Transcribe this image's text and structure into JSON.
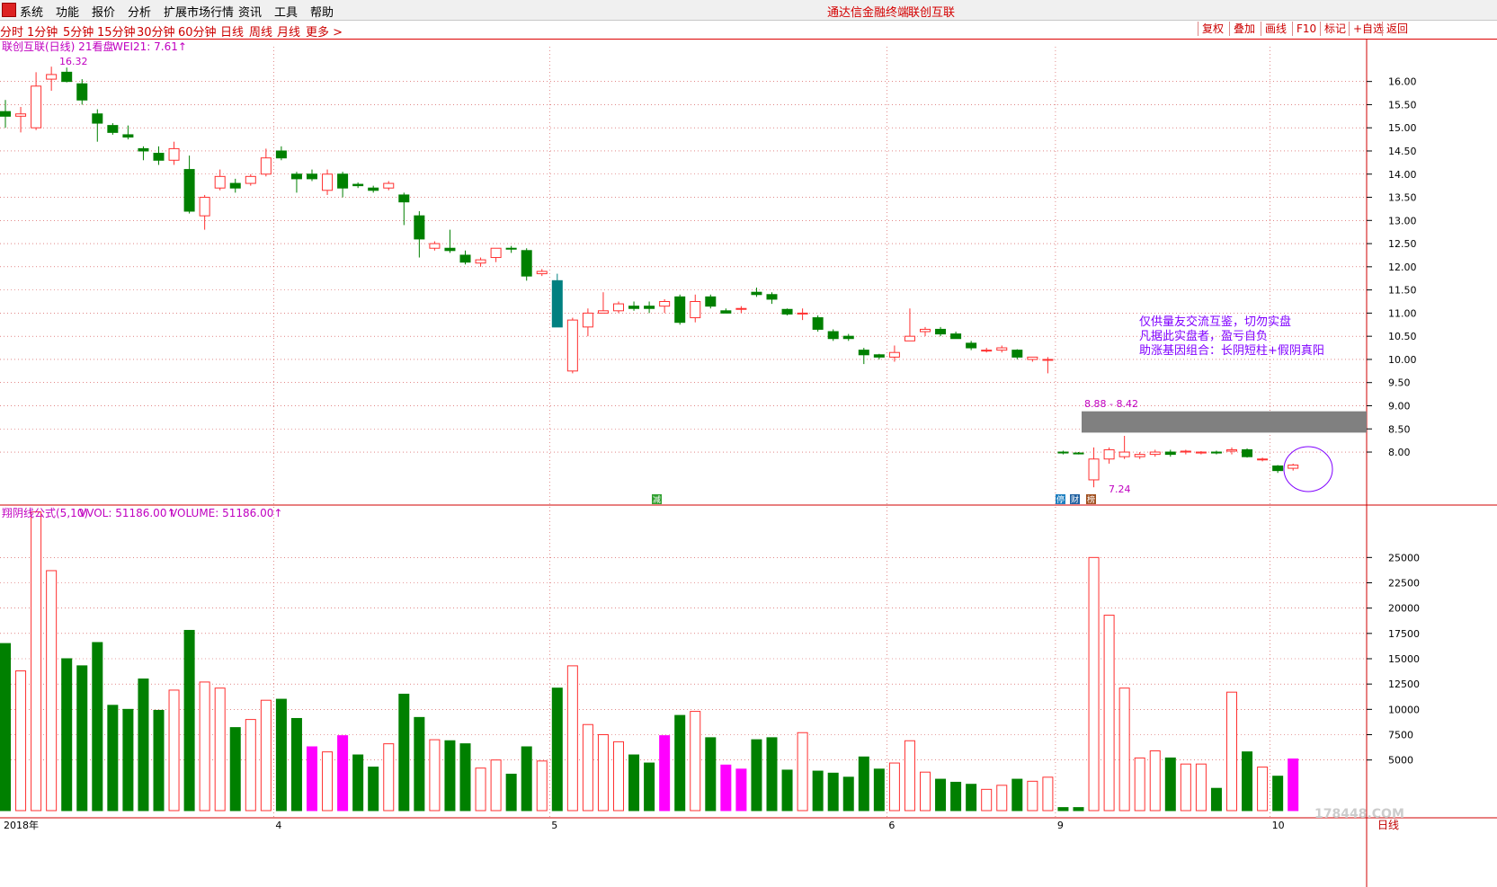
{
  "menu": [
    "系统",
    "功能",
    "报价",
    "分析",
    "扩展市场行情",
    "资讯",
    "工具",
    "帮助"
  ],
  "window_title": "通达信金融终端",
  "stock_name": "联创互联",
  "periods": [
    "分时",
    "1分钟",
    "5分钟",
    "15分钟",
    "30分钟",
    "60分钟",
    "日线",
    "周线",
    "月线",
    "更多 >"
  ],
  "active_period": "日线",
  "right_buttons": [
    "复权",
    "叠加",
    "画线",
    "F10",
    "标记",
    "+自选",
    "返回"
  ],
  "main_header": {
    "name": "联创互联(日线) 21看盘",
    "indicator": "WEI21: 7.61↑"
  },
  "vol_header": {
    "name": "翔阴线公式(5,10)",
    "vvol": "VVOL: 51186.00↑",
    "volume": "VOLUME: 51186.00↑"
  },
  "annotation": [
    "仅供量友交流互鉴，切勿实盘",
    "凡据此实盘者，盈亏自负",
    "助涨基因组合：长阴短柱+假阴真阳"
  ],
  "gap_label": "8.88 - 8.42",
  "max_label": "16.32",
  "min_label": "7.24",
  "icons": [
    "jian-icon",
    "ting-icon",
    "cai-icon",
    "bang-icon"
  ],
  "icon_labels": {
    "jian": "减",
    "ting": "停",
    "cai": "财",
    "bang": "榜"
  },
  "bottom_labels": {
    "year": "2018年",
    "period": "日线",
    "watermark": "178448.COM"
  },
  "colors": {
    "up": "#ff3030",
    "down": "#008000",
    "highlight": "#ff00ff",
    "teal": "#008080",
    "grid": "#d04040",
    "axis": "#000000"
  },
  "chart_data": {
    "type": "candlestick",
    "price_axis": {
      "ticks": [
        16.0,
        15.5,
        15.0,
        14.5,
        14.0,
        13.5,
        13.0,
        12.5,
        12.0,
        11.5,
        11.0,
        10.5,
        10.0,
        9.5,
        9.0,
        8.5,
        8.0
      ],
      "range": [
        7.05,
        16.75
      ]
    },
    "volume_axis": {
      "ticks": [
        25000,
        22500,
        20000,
        17500,
        15000,
        12500,
        10000,
        7500,
        5000
      ],
      "range": [
        0,
        30000
      ]
    },
    "month_labels": [
      {
        "label": "2018年",
        "index": 0
      },
      {
        "label": "4",
        "index": 18
      },
      {
        "label": "5",
        "index": 36
      },
      {
        "label": "6",
        "index": 58
      },
      {
        "label": "9",
        "index": 69
      },
      {
        "label": "10",
        "index": 83
      }
    ],
    "gap_zone": {
      "low": 8.42,
      "high": 8.88
    },
    "candles": [
      {
        "o": 15.35,
        "h": 15.6,
        "c": 15.25,
        "l": 15.0,
        "v": 16500
      },
      {
        "o": 15.25,
        "h": 15.45,
        "c": 15.3,
        "l": 14.9,
        "v": 13800
      },
      {
        "o": 15.0,
        "h": 16.2,
        "c": 15.9,
        "l": 14.95,
        "v": 29500
      },
      {
        "o": 16.05,
        "h": 16.32,
        "c": 16.15,
        "l": 15.8,
        "v": 23700
      },
      {
        "o": 16.2,
        "h": 16.3,
        "c": 16.0,
        "l": 15.98,
        "v": 15000
      },
      {
        "o": 15.95,
        "h": 16.05,
        "c": 15.6,
        "l": 15.5,
        "v": 14300
      },
      {
        "o": 15.3,
        "h": 15.4,
        "c": 15.1,
        "l": 14.7,
        "v": 16600
      },
      {
        "o": 15.05,
        "h": 15.1,
        "c": 14.9,
        "l": 14.85,
        "v": 10400
      },
      {
        "o": 14.85,
        "h": 15.05,
        "c": 14.8,
        "l": 14.75,
        "v": 10000
      },
      {
        "o": 14.55,
        "h": 14.6,
        "c": 14.5,
        "l": 14.3,
        "v": 13000
      },
      {
        "o": 14.45,
        "h": 14.6,
        "c": 14.3,
        "l": 14.2,
        "v": 9900
      },
      {
        "o": 14.3,
        "h": 14.7,
        "c": 14.55,
        "l": 14.2,
        "v": 11900
      },
      {
        "o": 14.1,
        "h": 14.4,
        "c": 13.2,
        "l": 13.15,
        "v": 17800
      },
      {
        "o": 13.1,
        "h": 13.55,
        "c": 13.5,
        "l": 12.8,
        "v": 12700
      },
      {
        "o": 13.7,
        "h": 14.1,
        "c": 13.95,
        "l": 13.65,
        "v": 12100
      },
      {
        "o": 13.8,
        "h": 13.9,
        "c": 13.7,
        "l": 13.6,
        "v": 8200
      },
      {
        "o": 13.8,
        "h": 14.0,
        "c": 13.95,
        "l": 13.75,
        "v": 9000
      },
      {
        "o": 14.0,
        "h": 14.55,
        "c": 14.35,
        "l": 13.95,
        "v": 10900
      },
      {
        "o": 14.5,
        "h": 14.6,
        "c": 14.35,
        "l": 14.3,
        "v": 11000
      },
      {
        "o": 14.0,
        "h": 14.05,
        "c": 13.9,
        "l": 13.6,
        "v": 9100
      },
      {
        "o": 14.0,
        "h": 14.1,
        "c": 13.9,
        "l": 13.85,
        "v": 6300
      },
      {
        "o": 13.65,
        "h": 14.1,
        "c": 14.0,
        "l": 13.55,
        "v": 5800
      },
      {
        "o": 14.0,
        "h": 14.05,
        "c": 13.7,
        "l": 13.5,
        "v": 7400
      },
      {
        "o": 13.78,
        "h": 13.82,
        "c": 13.75,
        "l": 13.7,
        "v": 5500
      },
      {
        "o": 13.7,
        "h": 13.75,
        "c": 13.65,
        "l": 13.6,
        "v": 4300
      },
      {
        "o": 13.7,
        "h": 13.85,
        "c": 13.8,
        "l": 13.65,
        "v": 6600
      },
      {
        "o": 13.55,
        "h": 13.6,
        "c": 13.4,
        "l": 12.9,
        "v": 11500
      },
      {
        "o": 13.1,
        "h": 13.2,
        "c": 12.6,
        "l": 12.2,
        "v": 9200
      },
      {
        "o": 12.4,
        "h": 12.55,
        "c": 12.5,
        "l": 12.35,
        "v": 7000
      },
      {
        "o": 12.4,
        "h": 12.8,
        "c": 12.35,
        "l": 12.3,
        "v": 6900
      },
      {
        "o": 12.25,
        "h": 12.35,
        "c": 12.1,
        "l": 12.05,
        "v": 6600
      },
      {
        "o": 12.08,
        "h": 12.2,
        "c": 12.15,
        "l": 12.0,
        "v": 4200
      },
      {
        "o": 12.2,
        "h": 12.35,
        "c": 12.4,
        "l": 12.1,
        "v": 5000
      },
      {
        "o": 12.4,
        "h": 12.45,
        "c": 12.38,
        "l": 12.3,
        "v": 3600
      },
      {
        "o": 12.35,
        "h": 12.4,
        "c": 11.8,
        "l": 11.7,
        "v": 6300
      },
      {
        "o": 11.85,
        "h": 11.95,
        "c": 11.9,
        "l": 11.8,
        "v": 4900
      },
      {
        "o": 11.7,
        "h": 11.85,
        "c": 10.7,
        "l": 10.7,
        "v": 12100
      },
      {
        "o": 9.75,
        "h": 10.9,
        "c": 10.85,
        "l": 9.7,
        "v": 14300
      },
      {
        "o": 10.7,
        "h": 11.1,
        "c": 11.0,
        "l": 10.5,
        "v": 8500
      },
      {
        "o": 11.0,
        "h": 11.45,
        "c": 11.05,
        "l": 11.0,
        "v": 7500
      },
      {
        "o": 11.05,
        "h": 11.25,
        "c": 11.2,
        "l": 11.0,
        "v": 6800
      },
      {
        "o": 11.15,
        "h": 11.25,
        "c": 11.1,
        "l": 11.05,
        "v": 5500
      },
      {
        "o": 11.15,
        "h": 11.25,
        "c": 11.1,
        "l": 11.0,
        "v": 4700
      },
      {
        "o": 11.15,
        "h": 11.3,
        "c": 11.25,
        "l": 11.0,
        "v": 7400
      },
      {
        "o": 11.35,
        "h": 11.4,
        "c": 10.8,
        "l": 10.75,
        "v": 9400
      },
      {
        "o": 10.9,
        "h": 11.4,
        "c": 11.25,
        "l": 10.8,
        "v": 9800
      },
      {
        "o": 11.35,
        "h": 11.4,
        "c": 11.15,
        "l": 11.1,
        "v": 7200
      },
      {
        "o": 11.05,
        "h": 11.1,
        "c": 11.0,
        "l": 11.0,
        "v": 4500
      },
      {
        "o": 11.1,
        "h": 11.15,
        "c": 11.1,
        "l": 11.0,
        "v": 4100
      },
      {
        "o": 11.45,
        "h": 11.55,
        "c": 11.4,
        "l": 11.35,
        "v": 7000
      },
      {
        "o": 11.4,
        "h": 11.45,
        "c": 11.3,
        "l": 11.2,
        "v": 7200
      },
      {
        "o": 11.08,
        "h": 11.1,
        "c": 10.98,
        "l": 10.95,
        "v": 4000
      },
      {
        "o": 11.0,
        "h": 11.1,
        "c": 11.0,
        "l": 10.85,
        "v": 7700
      },
      {
        "o": 10.9,
        "h": 10.95,
        "c": 10.65,
        "l": 10.6,
        "v": 3900
      },
      {
        "o": 10.6,
        "h": 10.65,
        "c": 10.45,
        "l": 10.4,
        "v": 3700
      },
      {
        "o": 10.5,
        "h": 10.55,
        "c": 10.45,
        "l": 10.4,
        "v": 3300
      },
      {
        "o": 10.2,
        "h": 10.25,
        "c": 10.1,
        "l": 9.9,
        "v": 5300
      },
      {
        "o": 10.1,
        "h": 10.12,
        "c": 10.05,
        "l": 10.0,
        "v": 4100
      },
      {
        "o": 10.05,
        "h": 10.3,
        "c": 10.15,
        "l": 9.95,
        "v": 4700
      },
      {
        "o": 10.4,
        "h": 11.1,
        "c": 10.5,
        "l": 10.4,
        "v": 6900
      },
      {
        "o": 10.6,
        "h": 10.7,
        "c": 10.65,
        "l": 10.5,
        "v": 3800
      },
      {
        "o": 10.65,
        "h": 10.7,
        "c": 10.55,
        "l": 10.5,
        "v": 3100
      },
      {
        "o": 10.55,
        "h": 10.6,
        "c": 10.45,
        "l": 10.45,
        "v": 2800
      },
      {
        "o": 10.35,
        "h": 10.4,
        "c": 10.25,
        "l": 10.2,
        "v": 2600
      },
      {
        "o": 10.2,
        "h": 10.25,
        "c": 10.2,
        "l": 10.15,
        "v": 2100
      },
      {
        "o": 10.2,
        "h": 10.3,
        "c": 10.25,
        "l": 10.15,
        "v": 2500
      },
      {
        "o": 10.2,
        "h": 10.22,
        "c": 10.05,
        "l": 10.0,
        "v": 3100
      },
      {
        "o": 10.0,
        "h": 10.05,
        "c": 10.05,
        "l": 9.95,
        "v": 2900
      },
      {
        "o": 10.0,
        "h": 10.05,
        "c": 10.0,
        "l": 9.7,
        "v": 3300
      },
      {
        "o": 8.0,
        "h": 8.03,
        "c": 7.98,
        "l": 7.95,
        "v": 300
      },
      {
        "o": 7.98,
        "h": 8.0,
        "c": 7.97,
        "l": 7.95,
        "v": 300
      },
      {
        "o": 7.4,
        "h": 8.1,
        "c": 7.85,
        "l": 7.24,
        "v": 25000
      },
      {
        "o": 7.85,
        "h": 8.1,
        "c": 8.05,
        "l": 7.75,
        "v": 19300
      },
      {
        "o": 7.9,
        "h": 8.35,
        "c": 8.0,
        "l": 7.85,
        "v": 12100
      },
      {
        "o": 7.9,
        "h": 8.0,
        "c": 7.95,
        "l": 7.85,
        "v": 5200
      },
      {
        "o": 7.95,
        "h": 8.05,
        "c": 8.0,
        "l": 7.9,
        "v": 5900
      },
      {
        "o": 8.0,
        "h": 8.05,
        "c": 7.95,
        "l": 7.9,
        "v": 5200
      },
      {
        "o": 8.0,
        "h": 8.05,
        "c": 8.02,
        "l": 7.95,
        "v": 4600
      },
      {
        "o": 7.98,
        "h": 8.02,
        "c": 8.0,
        "l": 7.95,
        "v": 4600
      },
      {
        "o": 8.0,
        "h": 8.03,
        "c": 7.98,
        "l": 7.95,
        "v": 2200
      },
      {
        "o": 8.02,
        "h": 8.1,
        "c": 8.05,
        "l": 7.95,
        "v": 11700
      },
      {
        "o": 8.05,
        "h": 8.08,
        "c": 7.9,
        "l": 7.88,
        "v": 5800
      },
      {
        "o": 7.85,
        "h": 7.88,
        "c": 7.85,
        "l": 7.8,
        "v": 4300
      },
      {
        "o": 7.7,
        "h": 7.72,
        "c": 7.6,
        "l": 7.55,
        "v": 3400
      },
      {
        "o": 7.65,
        "h": 7.75,
        "c": 7.72,
        "l": 7.6,
        "v": 5100
      }
    ]
  }
}
